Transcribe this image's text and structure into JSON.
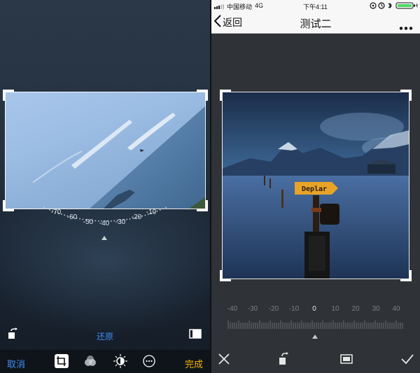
{
  "left": {
    "dial_labels": [
      "-70",
      "-60",
      "-50",
      "-40",
      "-30",
      "-20",
      "-10"
    ],
    "reset_label": "还原",
    "cancel_label": "取消",
    "done_label": "完成",
    "icons": [
      "rotate-icon",
      "aspect-ratio-icon",
      "crop-rotate-icon",
      "filters-icon",
      "adjust-icon",
      "more-icon"
    ],
    "accent_blue": "#3d8ef5",
    "accent_yellow": "#f5b400"
  },
  "right": {
    "status": {
      "carrier": "中国移动",
      "network": "4G",
      "time": "下午4:11",
      "battery_color": "#4cd964"
    },
    "nav": {
      "back_label": "返回",
      "title": "测试二"
    },
    "photo": {
      "sign_text": "Deplar"
    },
    "dial_labels": [
      "-40",
      "-30",
      "-20",
      "-10",
      "0",
      "10",
      "20",
      "30",
      "40"
    ],
    "selected_dial_value": "0",
    "icons": [
      "close-icon",
      "rotate-icon",
      "aspect-ratio-icon",
      "confirm-icon"
    ]
  }
}
